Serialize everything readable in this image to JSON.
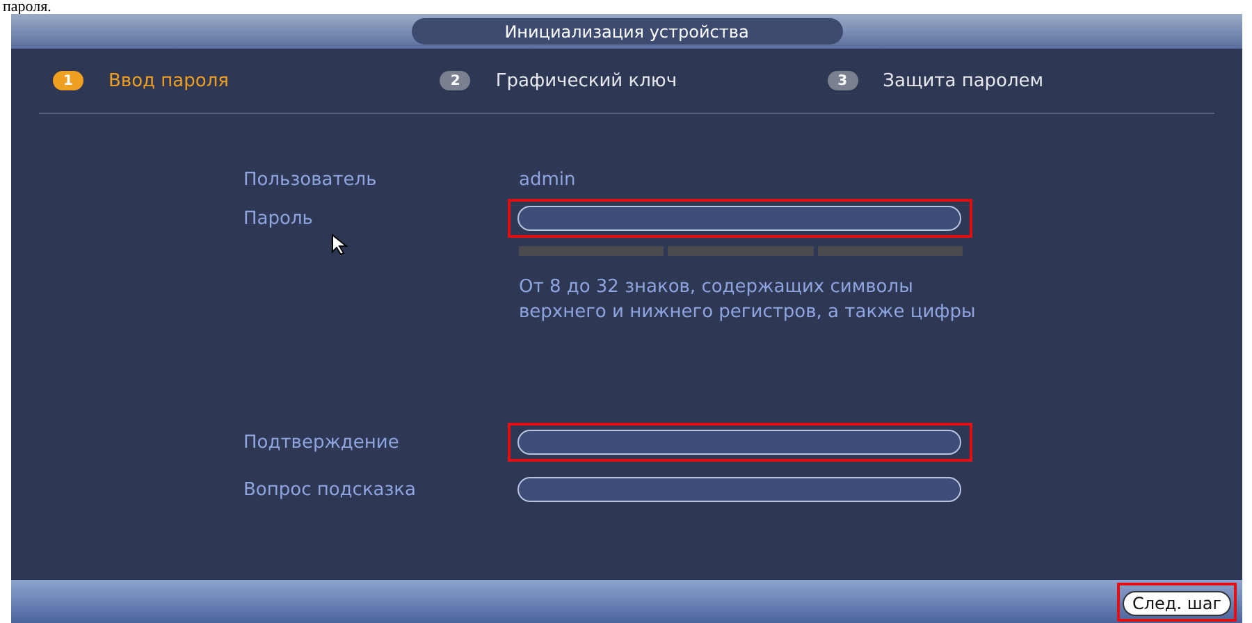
{
  "caption_fragment": "пароля.",
  "window": {
    "title": "Инициализация устройства"
  },
  "steps": [
    {
      "number": "1",
      "label": "Ввод пароля",
      "selected": true
    },
    {
      "number": "2",
      "label": "Графический ключ",
      "selected": false
    },
    {
      "number": "3",
      "label": "Защита паролем",
      "selected": false
    }
  ],
  "user": {
    "label": "Пользователь",
    "value": "admin"
  },
  "password": {
    "label": "Пароль",
    "highlighted": true
  },
  "strength": {
    "level": 0
  },
  "hint": [
    "От 8 до 32 знаков, содержащих символы",
    "верхнего и нижнего регистров, а также цифры"
  ],
  "fields": [
    {
      "label": "Подтверждение",
      "highlighted": true
    },
    {
      "label": "Вопрос подсказка",
      "highlighted": false
    }
  ],
  "next_button": {
    "label": "След. шаг",
    "highlighted": true
  }
}
